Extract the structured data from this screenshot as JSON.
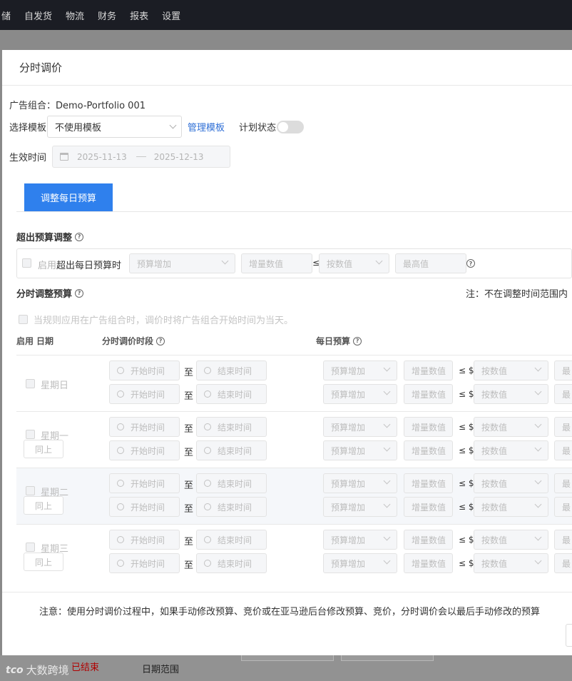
{
  "nav": {
    "items": [
      "储",
      "自发货",
      "物流",
      "财务",
      "报表",
      "设置"
    ]
  },
  "background": {
    "status_text": "已结束",
    "range_label": "日期范围",
    "watermark": "大数跨境",
    "watermark_mark": "tco"
  },
  "modal": {
    "title": "分时调价",
    "portfolio_label": "广告组合：Demo-Portfolio 001",
    "template_label": "选择模板",
    "template_value": "不使用模板",
    "manage_link": "管理模板",
    "plan_status_label": "计划状态",
    "effective_label": "生效时间",
    "date_start": "2025-11-13",
    "date_end": "2025-12-13",
    "tab_label": "调整每日预算"
  },
  "over_budget": {
    "title": "超出预算调整",
    "enable_text": "启用",
    "condition_text": "超出每日预算时",
    "type_placeholder": "预算增加",
    "amount_placeholder": "增量数值",
    "leq": "≤",
    "mode_placeholder": "按数值",
    "max_placeholder": "最高值"
  },
  "time_budget": {
    "title": "分时调整预算",
    "note_right": "注：不在调整时间范围内",
    "hint": "当规则应用在广告组合时，调价时将广告组合开始时间为当天。",
    "col_enable": "启用",
    "col_date": "日期",
    "col_period": "分时调价时段",
    "col_budget": "每日预算",
    "start_placeholder": "开始时间",
    "end_placeholder": "结束时间",
    "to_text": "至",
    "budget_type": "预算增加",
    "amount": "增量数值",
    "leq_dollar": "≤ $",
    "mode": "按数值",
    "max_trunc": "最",
    "same_btn": "同上",
    "days": [
      "星期日",
      "星期一",
      "星期二",
      "星期三"
    ]
  },
  "footer": {
    "note": "注意：使用分时调价过程中，如果手动修改预算、竞价或在亚马逊后台修改预算、竞价，分时调价会以最后手动修改的预算"
  }
}
